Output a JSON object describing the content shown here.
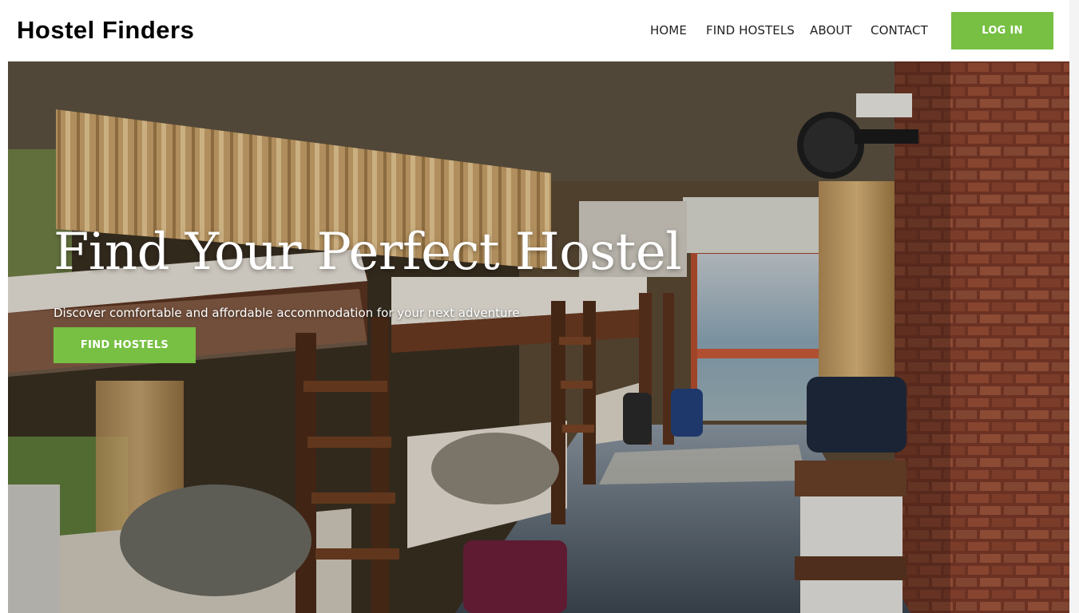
{
  "header": {
    "logo": "Hostel Finders",
    "nav": {
      "home": "HOME",
      "find_hostels": "FIND HOSTELS",
      "about": "ABOUT",
      "contact": "CONTACT"
    },
    "login_label": "LOG IN"
  },
  "hero": {
    "title": "Find Your Perfect Hostel",
    "subtitle": "Discover comfortable and affordable accommodation for your next adventure",
    "cta_label": "FIND HOSTELS",
    "background_image": "hostel-dorm-room-photo"
  },
  "colors": {
    "accent": "#77c043",
    "header_bg": "#ffffff",
    "text_dark": "#222222",
    "hero_text": "#ffffff"
  }
}
